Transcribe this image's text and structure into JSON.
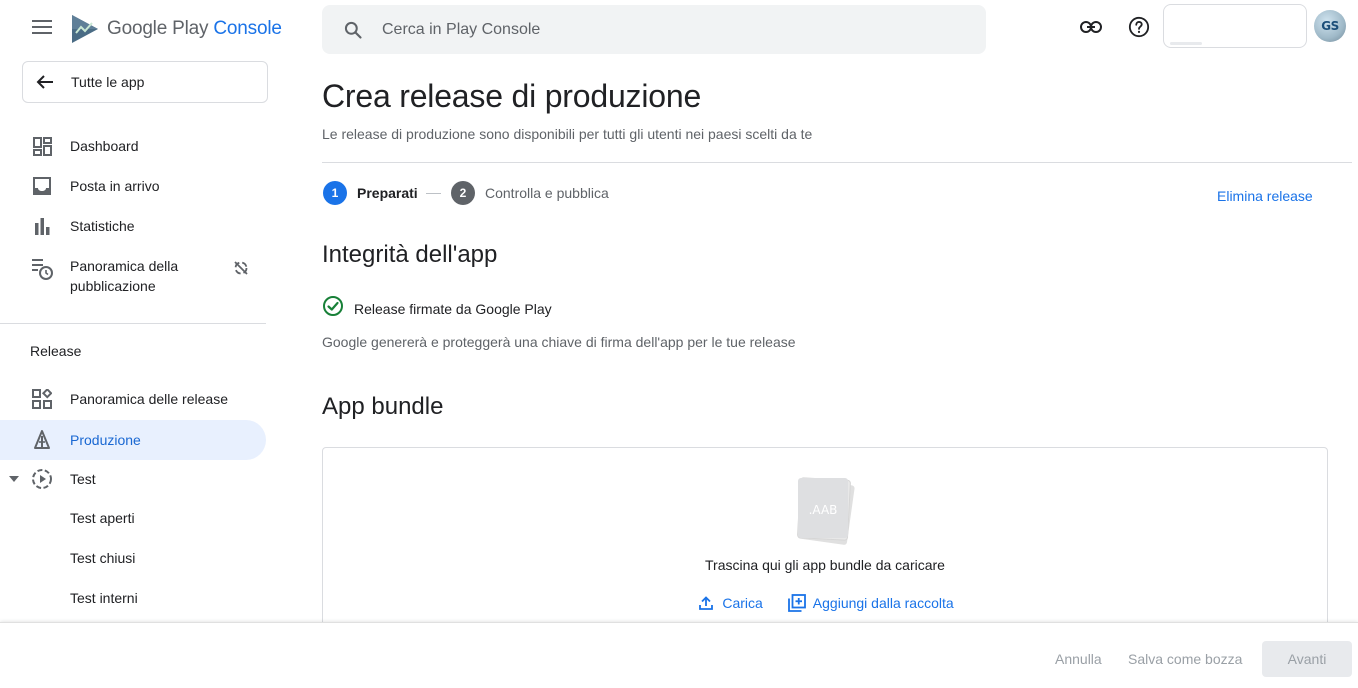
{
  "app": {
    "brand_main": "Google Play",
    "brand_console": "Console"
  },
  "search": {
    "placeholder": "Cerca in Play Console"
  },
  "account": {
    "avatar_initials": "GS"
  },
  "sidebar": {
    "back_label": "Tutte le app",
    "items": [
      {
        "label": "Dashboard",
        "icon": "dashboard-icon"
      },
      {
        "label": "Posta in arrivo",
        "icon": "inbox-icon"
      },
      {
        "label": "Statistiche",
        "icon": "bar-chart-icon"
      },
      {
        "label": "Panoramica della pubblicazione",
        "icon": "publishing-overview-icon",
        "trail_icon": "sync-disabled-icon"
      }
    ],
    "section_label": "Release",
    "release_items": [
      {
        "label": "Panoramica delle release",
        "icon": "release-overview-icon"
      },
      {
        "label": "Produzione",
        "icon": "production-icon",
        "active": true
      },
      {
        "label": "Test",
        "icon": "test-icon",
        "expanded": true
      }
    ],
    "test_subitems": [
      "Test aperti",
      "Test chiusi",
      "Test interni"
    ]
  },
  "main": {
    "title": "Crea release di produzione",
    "subtitle": "Le release di produzione sono disponibili per tutti gli utenti nei paesi scelti da te",
    "steps": [
      {
        "num": "1",
        "label": "Preparati",
        "active": true
      },
      {
        "num": "2",
        "label": "Controlla e pubblica",
        "active": false
      }
    ],
    "delete_release": "Elimina release",
    "integrity": {
      "heading": "Integrità dell'app",
      "check_label": "Release firmate da Google Play",
      "description": "Google genererà e proteggerà una chiave di firma dell'app per le tue release"
    },
    "bundle": {
      "heading": "App bundle",
      "file_badge": ".AAB",
      "drop_text": "Trascina qui gli app bundle da caricare",
      "upload_label": "Carica",
      "library_label": "Aggiungi dalla raccolta"
    }
  },
  "footer": {
    "cancel": "Annulla",
    "save_draft": "Salva come bozza",
    "next": "Avanti"
  },
  "colors": {
    "accent": "#1a73e8",
    "active_bg": "#e8f0fe",
    "success": "#188038",
    "step_inactive": "#5f6368",
    "disabled_text": "#9aa0a6"
  }
}
